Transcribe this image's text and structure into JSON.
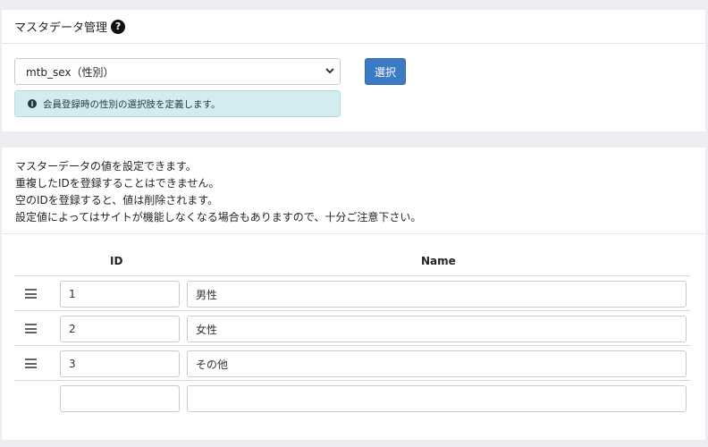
{
  "header": {
    "title": "マスタデータ管理"
  },
  "selector": {
    "value": "mtb_sex（性別）",
    "button_label": "選択",
    "info": "会員登録時の性別の選択肢を定義します。"
  },
  "description": [
    "マスターデータの値を設定できます。",
    "重複したIDを登録することはできません。",
    "空のIDを登録すると、値は削除されます。",
    "設定値によってはサイトが機能しなくなる場合もありますので、十分ご注意下さい。"
  ],
  "table": {
    "headers": {
      "id": "ID",
      "name": "Name"
    },
    "rows": [
      {
        "id": "1",
        "name": "男性"
      },
      {
        "id": "2",
        "name": "女性"
      },
      {
        "id": "3",
        "name": "その他"
      },
      {
        "id": "",
        "name": ""
      }
    ]
  },
  "colors": {
    "primary": "#3c7bc4",
    "info_bg": "#d3ecef",
    "page_bg": "#ecedf1"
  },
  "icons": {
    "help": "question-circle-icon",
    "info": "info-circle-icon",
    "drag": "drag-handle-icon",
    "chevron": "chevron-down-icon"
  }
}
